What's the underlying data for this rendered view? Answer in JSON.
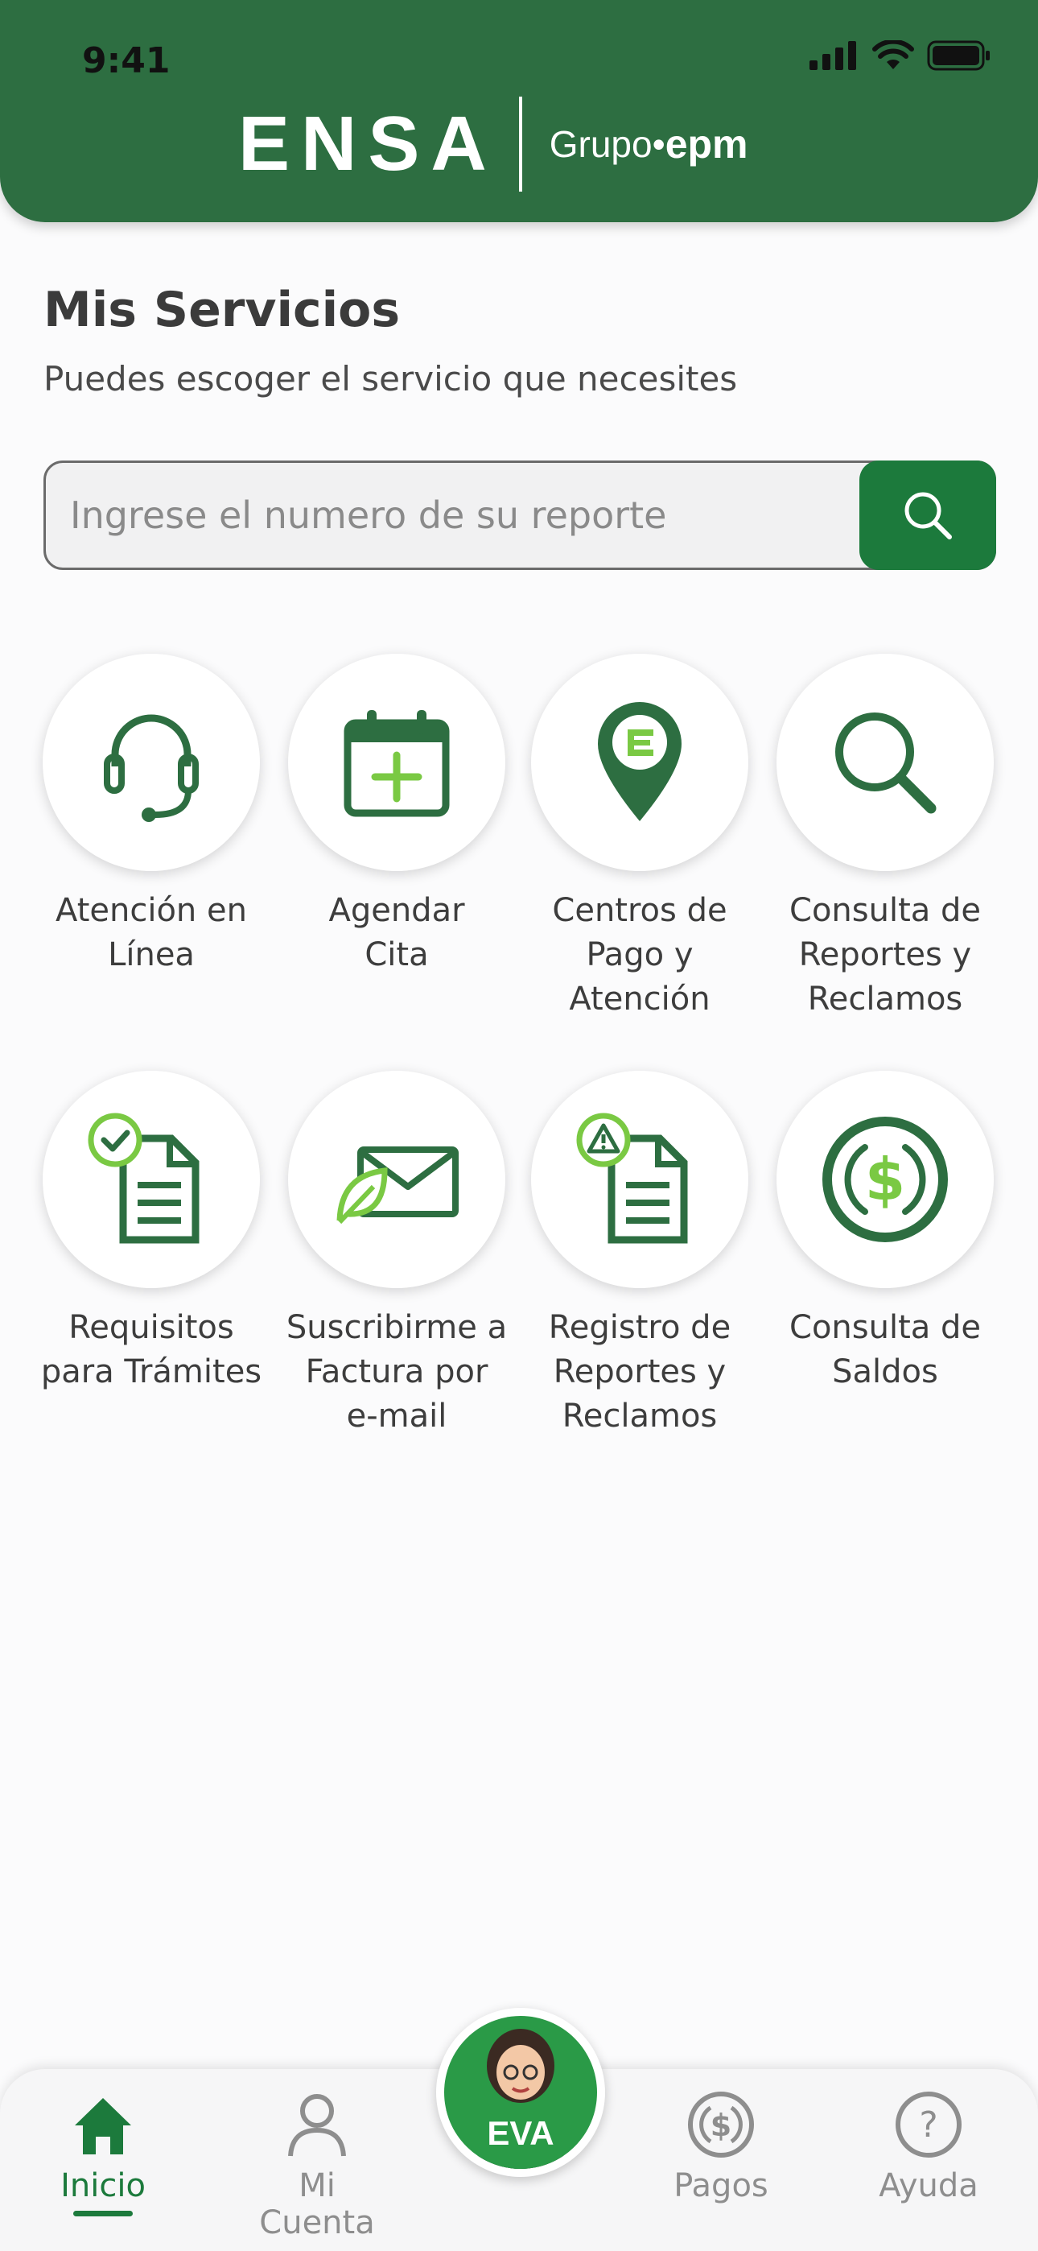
{
  "status": {
    "time": "9:41"
  },
  "brand": {
    "logo_text": "ENSA",
    "group_text": "Grupo",
    "group_brand": "epm"
  },
  "colors": {
    "primary": "#2d6e41",
    "accent_green": "#1c7a3c",
    "lime": "#7ac943"
  },
  "page": {
    "title": "Mis Servicios",
    "subtitle": "Puedes escoger el servicio que necesites"
  },
  "search": {
    "placeholder": "Ingrese el numero de su reporte",
    "icon": "search-icon"
  },
  "services": [
    {
      "label": "Atención en\nLínea",
      "icon": "headset-icon"
    },
    {
      "label": "Agendar\nCita",
      "icon": "calendar-add-icon"
    },
    {
      "label": "Centros de\nPago y\nAtención",
      "icon": "location-pin-icon"
    },
    {
      "label": "Consulta de\nReportes y\nReclamos",
      "icon": "magnifier-icon"
    },
    {
      "label": "Requisitos\npara Trámites",
      "icon": "document-check-icon"
    },
    {
      "label": "Suscribirme a\nFactura por\ne-mail",
      "icon": "envelope-leaf-icon"
    },
    {
      "label": "Registro de\nReportes y\nReclamos",
      "icon": "document-warning-icon"
    },
    {
      "label": "Consulta de\nSaldos",
      "icon": "dollar-coin-icon"
    }
  ],
  "tabbar": {
    "inicio": "Inicio",
    "mi_cuenta": "Mi Cuenta",
    "eva": "EVA",
    "pagos": "Pagos",
    "ayuda": "Ayuda",
    "active": "Inicio"
  }
}
